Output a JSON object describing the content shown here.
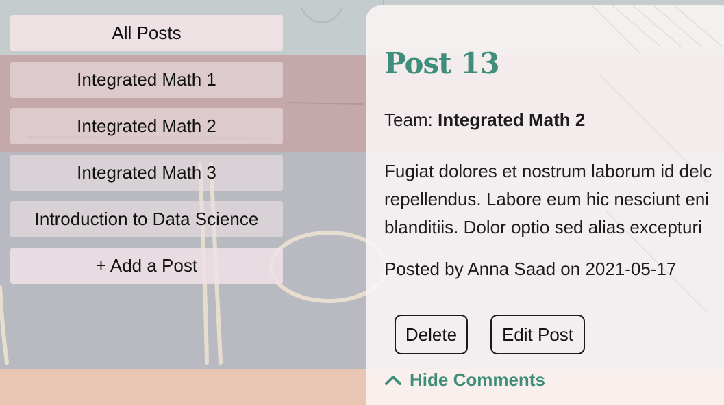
{
  "sidebar": {
    "items": [
      {
        "label": "All Posts"
      },
      {
        "label": "Integrated Math 1"
      },
      {
        "label": "Integrated Math 2"
      },
      {
        "label": "Integrated Math 3"
      },
      {
        "label": "Introduction to Data Science"
      },
      {
        "label": "+ Add a Post"
      }
    ]
  },
  "post": {
    "title": "Post 13",
    "team_prefix": "Team:",
    "team_name": "Integrated Math 2",
    "body_lines": [
      "Fugiat dolores et nostrum laborum id delc",
      "repellendus. Labore eum hic nesciunt eni",
      "blanditiis. Dolor optio sed alias excepturi"
    ],
    "posted_line": "Posted by Anna Saad on 2021-05-17",
    "delete_label": "Delete",
    "edit_label": "Edit Post",
    "comments_toggle_label": "Hide Comments"
  },
  "colors": {
    "accent": "#3f8e7c",
    "background": "#bbbcc2"
  },
  "icons": {
    "comments_toggle": "chevron-up-icon"
  }
}
